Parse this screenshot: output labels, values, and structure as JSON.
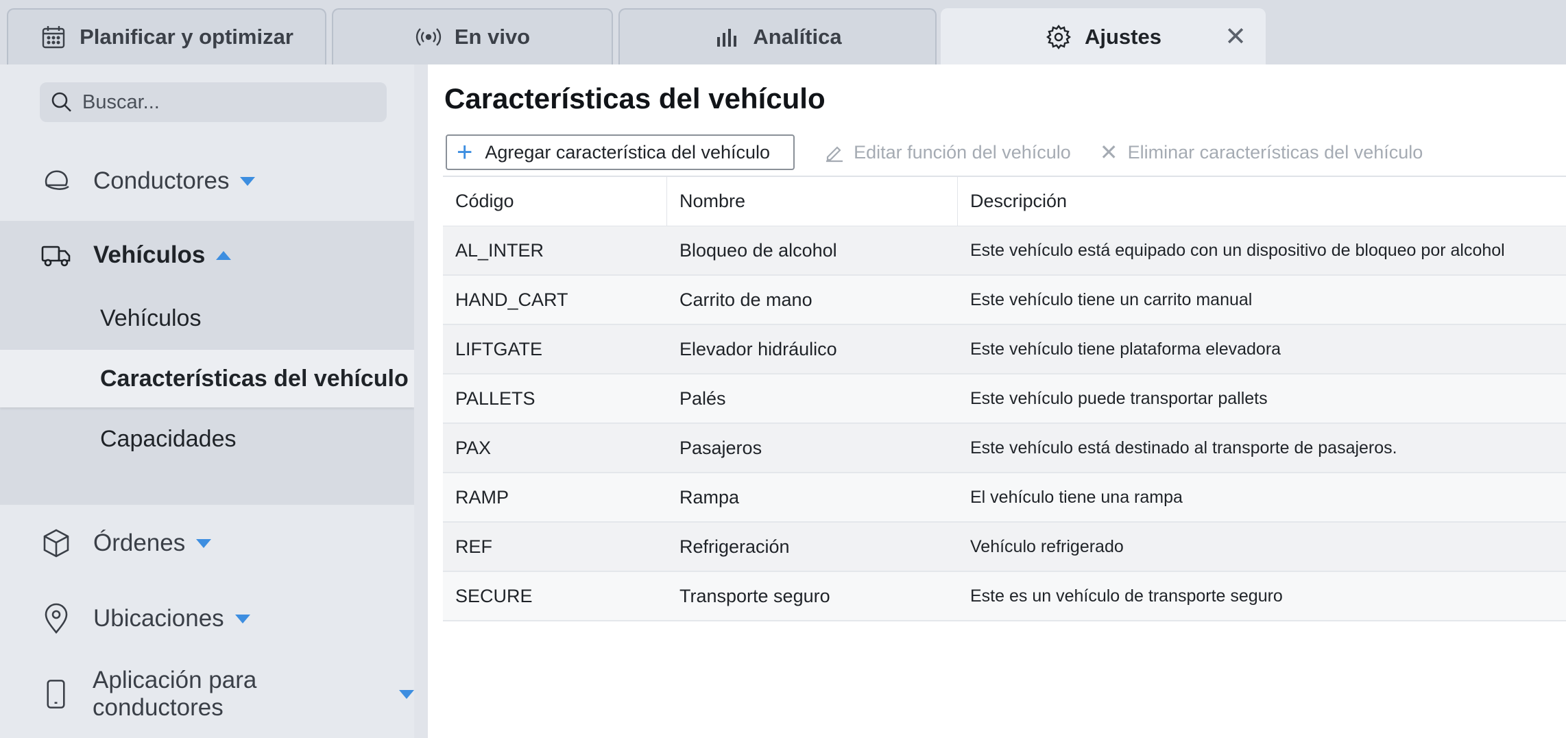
{
  "tabs": [
    {
      "label": "Planificar y optimizar",
      "icon": "calendar-icon"
    },
    {
      "label": "En vivo",
      "icon": "live-broadcast-icon"
    },
    {
      "label": "Analítica",
      "icon": "bar-chart-icon"
    },
    {
      "label": "Ajustes",
      "icon": "gear-icon",
      "active": true,
      "closable": true
    }
  ],
  "sidebar": {
    "search_placeholder": "Buscar...",
    "items": [
      {
        "label": "Conductores",
        "icon": "cap-icon",
        "expanded": false
      },
      {
        "label": "Vehículos",
        "icon": "truck-icon",
        "expanded": true,
        "children": [
          "Vehículos",
          "Características del vehículo",
          "Capacidades"
        ],
        "selected": "Características del vehículo"
      },
      {
        "label": "Órdenes",
        "icon": "box-icon",
        "expanded": false
      },
      {
        "label": "Ubicaciones",
        "icon": "location-pin-icon",
        "expanded": false
      },
      {
        "label": "Aplicación para conductores",
        "icon": "mobile-phone-icon",
        "expanded": false
      }
    ]
  },
  "main": {
    "title": "Características del vehículo",
    "toolbar": {
      "add_label": "Agregar característica del vehículo",
      "edit_label": "Editar función del vehículo",
      "delete_label": "Eliminar características del vehículo"
    },
    "table": {
      "columns": [
        "Código",
        "Nombre",
        "Descripción"
      ],
      "rows": [
        [
          "AL_INTER",
          "Bloqueo de alcohol",
          "Este vehículo está equipado con un dispositivo de bloqueo por alcohol"
        ],
        [
          "HAND_CART",
          "Carrito de mano",
          "Este vehículo tiene un carrito manual"
        ],
        [
          "LIFTGATE",
          "Elevador hidráulico",
          "Este vehículo tiene plataforma elevadora"
        ],
        [
          "PALLETS",
          "Palés",
          "Este vehículo puede transportar pallets"
        ],
        [
          "PAX",
          "Pasajeros",
          "Este vehículo está destinado al transporte de pasajeros."
        ],
        [
          "RAMP",
          "Rampa",
          "El vehículo tiene una rampa"
        ],
        [
          "REF",
          "Refrigeración",
          "Vehículo refrigerado"
        ],
        [
          "SECURE",
          "Transporte seguro",
          "Este es un vehículo de transporte seguro"
        ]
      ]
    }
  },
  "colors": {
    "accent": "#3d8ee0",
    "sidebar_bg": "#e6e9ee",
    "selected_group_bg": "#d7dbe2"
  }
}
